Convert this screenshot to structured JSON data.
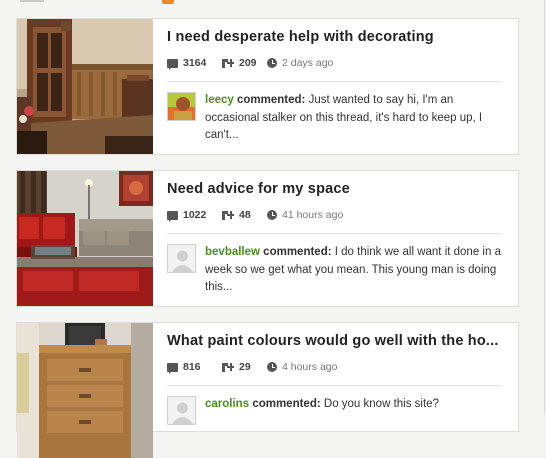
{
  "threads": [
    {
      "title": "I need desperate help with decorating",
      "comments": "3164",
      "follows": "209",
      "time": "2 days ago",
      "last_comment": {
        "user": "leecy",
        "verb": "commented:",
        "text": "Just wanted to say hi, I'm an occasional stalker on this thread, it's hard to keep up, I can't..."
      }
    },
    {
      "title": "Need advice for my space",
      "comments": "1022",
      "follows": "48",
      "time": "41 hours ago",
      "last_comment": {
        "user": "bevballew",
        "verb": "commented:",
        "text": "I do think we all want it done in a week so we get what you mean. This young man is doing this..."
      }
    },
    {
      "title": "What paint colours would go well with the ho...",
      "comments": "816",
      "follows": "29",
      "time": "4 hours ago",
      "last_comment": {
        "user": "carolins",
        "verb": "commented:",
        "text": "Do you know this site?"
      }
    }
  ],
  "colors": {
    "username": "#4a8f1a",
    "icon": "#555555",
    "rss": "#f08a24"
  },
  "icons": [
    "comment-bubble-icon",
    "follow-plus-icon",
    "clock-icon",
    "rss-icon",
    "default-avatar-icon"
  ]
}
